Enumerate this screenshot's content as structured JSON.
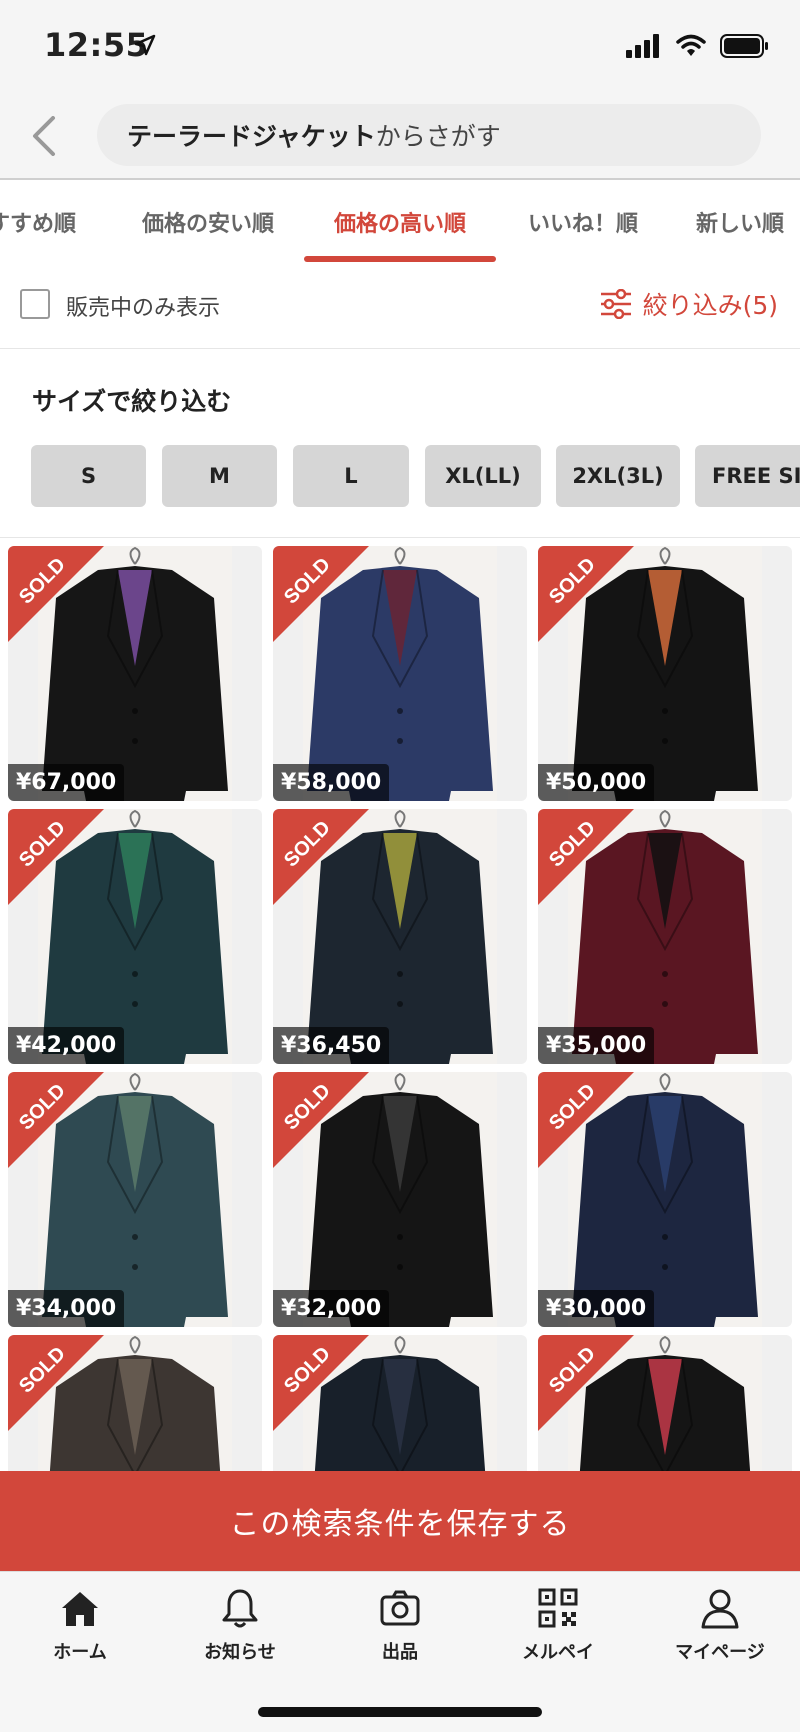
{
  "status_bar": {
    "time": "12:55"
  },
  "header": {
    "search_term": "テーラードジャケット",
    "search_suffix": "からさがす"
  },
  "tabs": [
    {
      "label": "すすめ順"
    },
    {
      "label": "価格の安い順"
    },
    {
      "label": "価格の高い順"
    },
    {
      "label": "いいね！順"
    },
    {
      "label": "新しい順"
    }
  ],
  "filter_row": {
    "checkbox_label": "販売中のみ表示",
    "refine_label": "絞り込み(5)"
  },
  "size_filter": {
    "title": "サイズで絞り込む",
    "options": [
      "S",
      "M",
      "L",
      "XL(LL)",
      "2XL(3L)",
      "FREE SIZE"
    ]
  },
  "products": [
    {
      "price": "¥67,000",
      "sold_label": "SOLD",
      "color": "#161616",
      "accent": "#7a4ea0"
    },
    {
      "price": "¥58,000",
      "sold_label": "SOLD",
      "color": "#2c3a66",
      "accent": "#6a2434"
    },
    {
      "price": "¥50,000",
      "sold_label": "SOLD",
      "color": "#141414",
      "accent": "#d06a3a"
    },
    {
      "price": "¥42,000",
      "sold_label": "SOLD",
      "color": "#1f3a40",
      "accent": "#2e7d5b"
    },
    {
      "price": "¥36,450",
      "sold_label": "SOLD",
      "color": "#1d2630",
      "accent": "#a6a23c"
    },
    {
      "price": "¥35,000",
      "sold_label": "SOLD",
      "color": "#5a1622",
      "accent": "#111111"
    },
    {
      "price": "¥34,000",
      "sold_label": "SOLD",
      "color": "#2f4a52",
      "accent": "#5b7a6a"
    },
    {
      "price": "¥32,000",
      "sold_label": "SOLD",
      "color": "#151515",
      "accent": "#3a3a3a"
    },
    {
      "price": "¥30,000",
      "sold_label": "SOLD",
      "color": "#1d2640",
      "accent": "#2a3f6e"
    },
    {
      "price": "",
      "sold_label": "SOLD",
      "color": "#3d3632",
      "accent": "#6b5f55"
    },
    {
      "price": "",
      "sold_label": "SOLD",
      "color": "#18202a",
      "accent": "#2a3344"
    },
    {
      "price": "",
      "sold_label": "SOLD",
      "color": "#151515",
      "accent": "#c43a4a"
    }
  ],
  "save_button": {
    "label": "この検索条件を保存する"
  },
  "bottom_nav": [
    {
      "label": "ホーム",
      "icon": "home-icon"
    },
    {
      "label": "お知らせ",
      "icon": "bell-icon"
    },
    {
      "label": "出品",
      "icon": "camera-icon"
    },
    {
      "label": "メルペイ",
      "icon": "qr-code-icon"
    },
    {
      "label": "マイページ",
      "icon": "person-icon"
    }
  ],
  "colors": {
    "accent": "#d2473b",
    "background": "#ffffff"
  }
}
